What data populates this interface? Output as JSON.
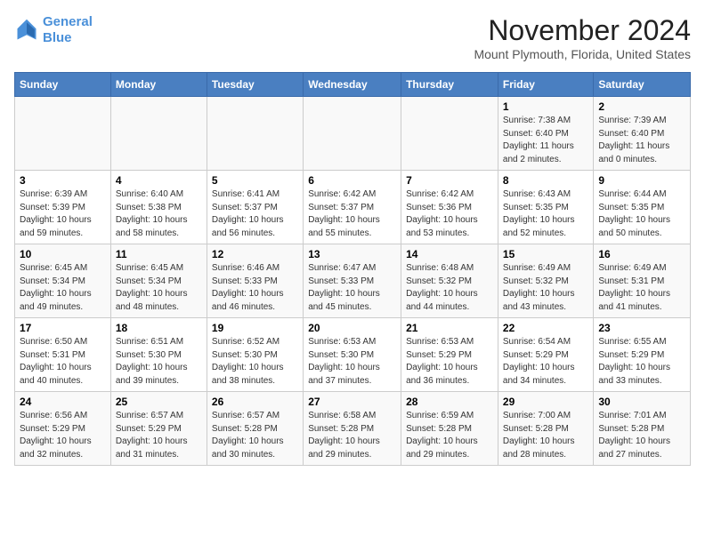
{
  "header": {
    "logo_line1": "General",
    "logo_line2": "Blue",
    "title": "November 2024",
    "subtitle": "Mount Plymouth, Florida, United States"
  },
  "calendar": {
    "days_of_week": [
      "Sunday",
      "Monday",
      "Tuesday",
      "Wednesday",
      "Thursday",
      "Friday",
      "Saturday"
    ],
    "weeks": [
      [
        {
          "day": "",
          "info": ""
        },
        {
          "day": "",
          "info": ""
        },
        {
          "day": "",
          "info": ""
        },
        {
          "day": "",
          "info": ""
        },
        {
          "day": "",
          "info": ""
        },
        {
          "day": "1",
          "info": "Sunrise: 7:38 AM\nSunset: 6:40 PM\nDaylight: 11 hours\nand 2 minutes."
        },
        {
          "day": "2",
          "info": "Sunrise: 7:39 AM\nSunset: 6:40 PM\nDaylight: 11 hours\nand 0 minutes."
        }
      ],
      [
        {
          "day": "3",
          "info": "Sunrise: 6:39 AM\nSunset: 5:39 PM\nDaylight: 10 hours\nand 59 minutes."
        },
        {
          "day": "4",
          "info": "Sunrise: 6:40 AM\nSunset: 5:38 PM\nDaylight: 10 hours\nand 58 minutes."
        },
        {
          "day": "5",
          "info": "Sunrise: 6:41 AM\nSunset: 5:37 PM\nDaylight: 10 hours\nand 56 minutes."
        },
        {
          "day": "6",
          "info": "Sunrise: 6:42 AM\nSunset: 5:37 PM\nDaylight: 10 hours\nand 55 minutes."
        },
        {
          "day": "7",
          "info": "Sunrise: 6:42 AM\nSunset: 5:36 PM\nDaylight: 10 hours\nand 53 minutes."
        },
        {
          "day": "8",
          "info": "Sunrise: 6:43 AM\nSunset: 5:35 PM\nDaylight: 10 hours\nand 52 minutes."
        },
        {
          "day": "9",
          "info": "Sunrise: 6:44 AM\nSunset: 5:35 PM\nDaylight: 10 hours\nand 50 minutes."
        }
      ],
      [
        {
          "day": "10",
          "info": "Sunrise: 6:45 AM\nSunset: 5:34 PM\nDaylight: 10 hours\nand 49 minutes."
        },
        {
          "day": "11",
          "info": "Sunrise: 6:45 AM\nSunset: 5:34 PM\nDaylight: 10 hours\nand 48 minutes."
        },
        {
          "day": "12",
          "info": "Sunrise: 6:46 AM\nSunset: 5:33 PM\nDaylight: 10 hours\nand 46 minutes."
        },
        {
          "day": "13",
          "info": "Sunrise: 6:47 AM\nSunset: 5:33 PM\nDaylight: 10 hours\nand 45 minutes."
        },
        {
          "day": "14",
          "info": "Sunrise: 6:48 AM\nSunset: 5:32 PM\nDaylight: 10 hours\nand 44 minutes."
        },
        {
          "day": "15",
          "info": "Sunrise: 6:49 AM\nSunset: 5:32 PM\nDaylight: 10 hours\nand 43 minutes."
        },
        {
          "day": "16",
          "info": "Sunrise: 6:49 AM\nSunset: 5:31 PM\nDaylight: 10 hours\nand 41 minutes."
        }
      ],
      [
        {
          "day": "17",
          "info": "Sunrise: 6:50 AM\nSunset: 5:31 PM\nDaylight: 10 hours\nand 40 minutes."
        },
        {
          "day": "18",
          "info": "Sunrise: 6:51 AM\nSunset: 5:30 PM\nDaylight: 10 hours\nand 39 minutes."
        },
        {
          "day": "19",
          "info": "Sunrise: 6:52 AM\nSunset: 5:30 PM\nDaylight: 10 hours\nand 38 minutes."
        },
        {
          "day": "20",
          "info": "Sunrise: 6:53 AM\nSunset: 5:30 PM\nDaylight: 10 hours\nand 37 minutes."
        },
        {
          "day": "21",
          "info": "Sunrise: 6:53 AM\nSunset: 5:29 PM\nDaylight: 10 hours\nand 36 minutes."
        },
        {
          "day": "22",
          "info": "Sunrise: 6:54 AM\nSunset: 5:29 PM\nDaylight: 10 hours\nand 34 minutes."
        },
        {
          "day": "23",
          "info": "Sunrise: 6:55 AM\nSunset: 5:29 PM\nDaylight: 10 hours\nand 33 minutes."
        }
      ],
      [
        {
          "day": "24",
          "info": "Sunrise: 6:56 AM\nSunset: 5:29 PM\nDaylight: 10 hours\nand 32 minutes."
        },
        {
          "day": "25",
          "info": "Sunrise: 6:57 AM\nSunset: 5:29 PM\nDaylight: 10 hours\nand 31 minutes."
        },
        {
          "day": "26",
          "info": "Sunrise: 6:57 AM\nSunset: 5:28 PM\nDaylight: 10 hours\nand 30 minutes."
        },
        {
          "day": "27",
          "info": "Sunrise: 6:58 AM\nSunset: 5:28 PM\nDaylight: 10 hours\nand 29 minutes."
        },
        {
          "day": "28",
          "info": "Sunrise: 6:59 AM\nSunset: 5:28 PM\nDaylight: 10 hours\nand 29 minutes."
        },
        {
          "day": "29",
          "info": "Sunrise: 7:00 AM\nSunset: 5:28 PM\nDaylight: 10 hours\nand 28 minutes."
        },
        {
          "day": "30",
          "info": "Sunrise: 7:01 AM\nSunset: 5:28 PM\nDaylight: 10 hours\nand 27 minutes."
        }
      ]
    ]
  }
}
